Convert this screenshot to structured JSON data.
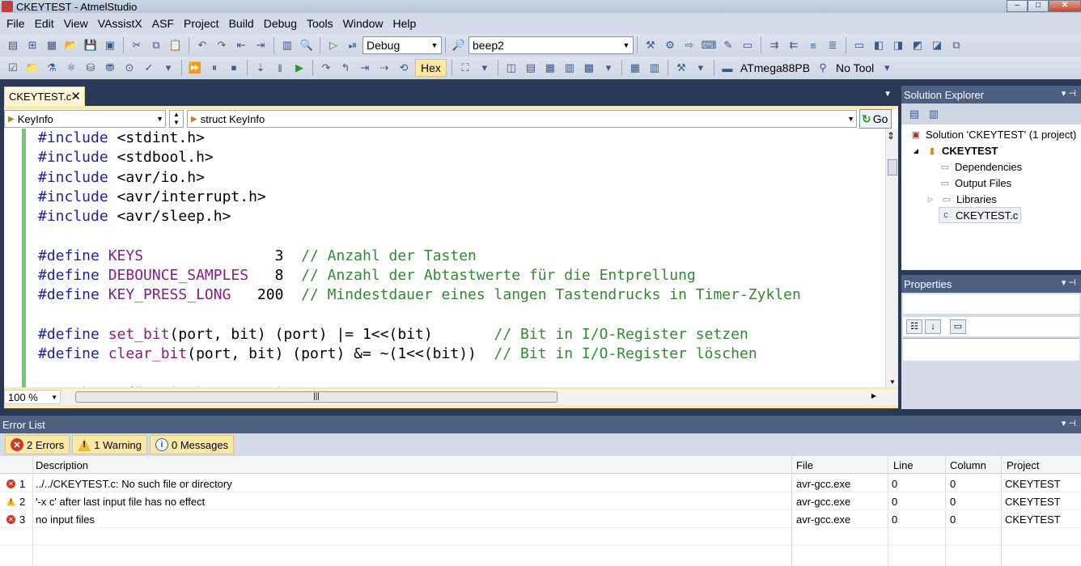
{
  "window": {
    "title": "CKEYTEST - AtmelStudio"
  },
  "menu": [
    "File",
    "Edit",
    "View",
    "VAssistX",
    "ASF",
    "Project",
    "Build",
    "Debug",
    "Tools",
    "Window",
    "Help"
  ],
  "toolbar": {
    "config": "Debug",
    "search": "beep2",
    "hex_label": "Hex",
    "device": "ATmega88PB",
    "tool": "No Tool"
  },
  "editor": {
    "tab_label": "CKEYTEST.c",
    "nav_scope": "KeyInfo",
    "nav_member": "struct KeyInfo",
    "go_label": "Go",
    "zoom": "100 %"
  },
  "code_lines": [
    [
      {
        "t": "k",
        "v": "#include"
      },
      {
        "t": "t",
        "v": " <stdint.h>"
      }
    ],
    [
      {
        "t": "k",
        "v": "#include"
      },
      {
        "t": "t",
        "v": " <stdbool.h>"
      }
    ],
    [
      {
        "t": "k",
        "v": "#include"
      },
      {
        "t": "t",
        "v": " <avr/io.h>"
      }
    ],
    [
      {
        "t": "k",
        "v": "#include"
      },
      {
        "t": "t",
        "v": " <avr/interrupt.h>"
      }
    ],
    [
      {
        "t": "k",
        "v": "#include"
      },
      {
        "t": "t",
        "v": " <avr/sleep.h>"
      }
    ],
    [],
    [
      {
        "t": "k",
        "v": "#define"
      },
      {
        "t": "t",
        "v": " "
      },
      {
        "t": "m",
        "v": "KEYS"
      },
      {
        "t": "t",
        "v": "               3  "
      },
      {
        "t": "c",
        "v": "// Anzahl der Tasten"
      }
    ],
    [
      {
        "t": "k",
        "v": "#define"
      },
      {
        "t": "t",
        "v": " "
      },
      {
        "t": "m",
        "v": "DEBOUNCE_SAMPLES"
      },
      {
        "t": "t",
        "v": "   8  "
      },
      {
        "t": "c",
        "v": "// Anzahl der Abtastwerte für die Entprellung"
      }
    ],
    [
      {
        "t": "k",
        "v": "#define"
      },
      {
        "t": "t",
        "v": " "
      },
      {
        "t": "m",
        "v": "KEY_PRESS_LONG"
      },
      {
        "t": "t",
        "v": "   200  "
      },
      {
        "t": "c",
        "v": "// Mindestdauer eines langen Tastendrucks in Timer-Zyklen"
      }
    ],
    [],
    [
      {
        "t": "k",
        "v": "#define"
      },
      {
        "t": "t",
        "v": " "
      },
      {
        "t": "m",
        "v": "set_bit"
      },
      {
        "t": "t",
        "v": "(port, bit) (port) |= 1<<(bit)       "
      },
      {
        "t": "c",
        "v": "// Bit in I/O-Register setzen"
      }
    ],
    [
      {
        "t": "k",
        "v": "#define"
      },
      {
        "t": "t",
        "v": " "
      },
      {
        "t": "m",
        "v": "clear_bit"
      },
      {
        "t": "t",
        "v": "(port, bit) (port) &= ~(1<<(bit))  "
      },
      {
        "t": "c",
        "v": "// Bit in I/O-Register löschen"
      }
    ],
    [],
    [
      {
        "t": "c",
        "v": "// Makros für Bitoberoperationen"
      }
    ]
  ],
  "solution_explorer": {
    "title": "Solution Explorer",
    "items": [
      {
        "label": "Solution 'CKEYTEST' (1 project)",
        "bold": false
      },
      {
        "label": "CKEYTEST",
        "bold": true
      },
      {
        "label": "Dependencies",
        "bold": false
      },
      {
        "label": "Output Files",
        "bold": false
      },
      {
        "label": "Libraries",
        "bold": false
      },
      {
        "label": "CKEYTEST.c",
        "bold": false
      }
    ]
  },
  "properties": {
    "title": "Properties"
  },
  "error_list": {
    "title": "Error List",
    "filters": {
      "errors": "2 Errors",
      "warnings": "1 Warning",
      "messages": "0 Messages"
    },
    "columns": [
      "Description",
      "File",
      "Line",
      "Column",
      "Project"
    ],
    "rows": [
      {
        "kind": "error",
        "num": "1",
        "desc": "../../CKEYTEST.c: No such file or directory",
        "file": "avr-gcc.exe",
        "line": "0",
        "col": "0",
        "project": "CKEYTEST"
      },
      {
        "kind": "warning",
        "num": "2",
        "desc": "'-x c' after last input file has no effect",
        "file": "avr-gcc.exe",
        "line": "0",
        "col": "0",
        "project": "CKEYTEST"
      },
      {
        "kind": "error",
        "num": "3",
        "desc": "no input files",
        "file": "avr-gcc.exe",
        "line": "0",
        "col": "0",
        "project": "CKEYTEST"
      }
    ]
  }
}
